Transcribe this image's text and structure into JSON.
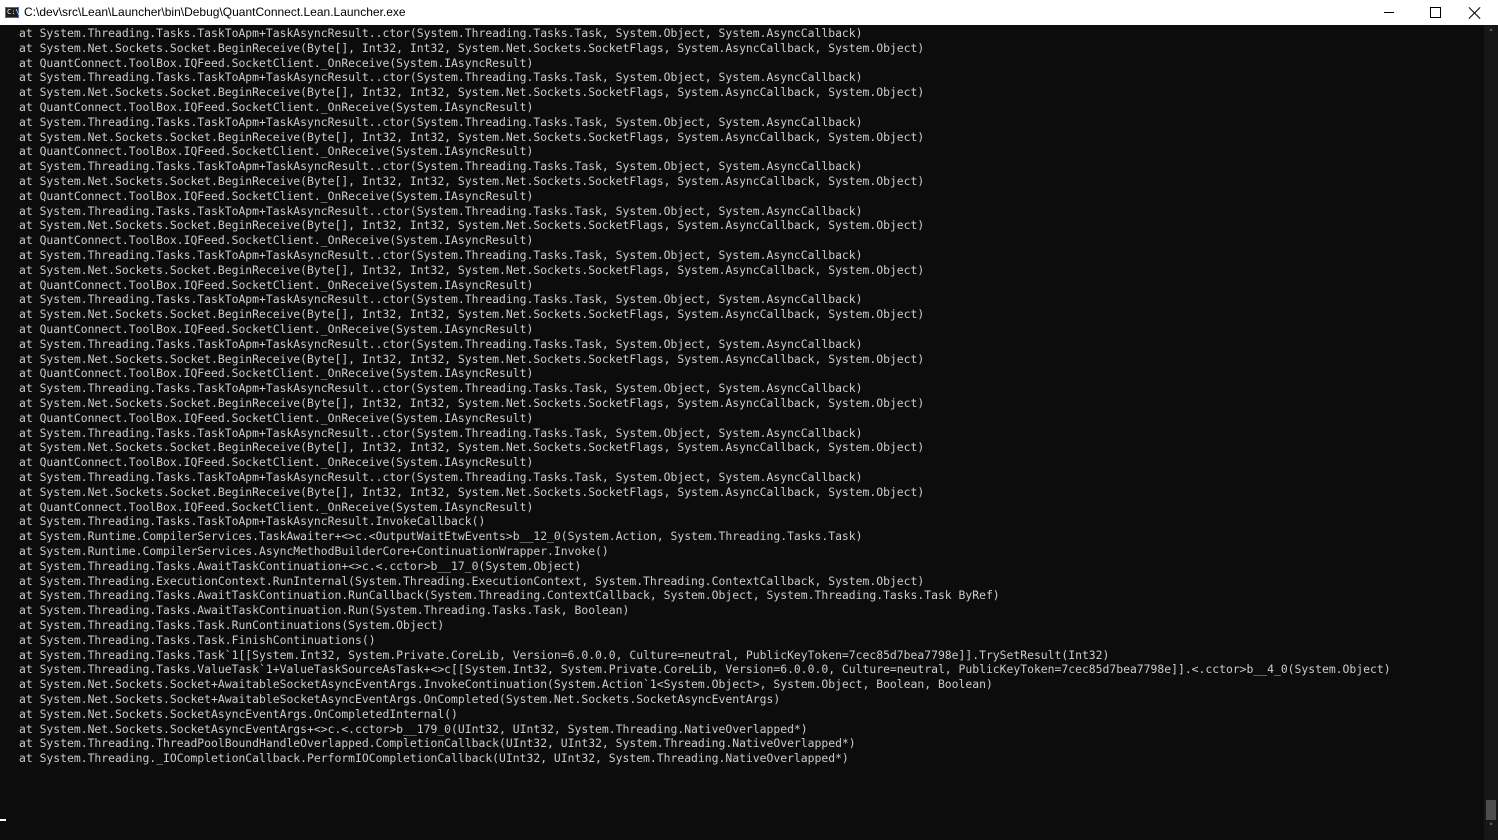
{
  "window": {
    "title": "C:\\dev\\src\\Lean\\Launcher\\bin\\Debug\\QuantConnect.Lean.Launcher.exe",
    "icon_label": "C:\\",
    "icon": "console-app-icon",
    "controls": {
      "minimize_icon": "minimize-icon",
      "maximize_icon": "maximize-icon",
      "close_icon": "close-icon"
    }
  },
  "colors": {
    "console_background": "#0c0c0c",
    "console_text": "#cccccc",
    "titlebar_background": "#ffffff"
  },
  "scrollbar": {
    "up_glyph": "˄",
    "down_glyph": "˅"
  },
  "console_lines": [
    "at System.Threading.Tasks.TaskToApm+TaskAsyncResult..ctor(System.Threading.Tasks.Task, System.Object, System.AsyncCallback)",
    "at System.Net.Sockets.Socket.BeginReceive(Byte[], Int32, Int32, System.Net.Sockets.SocketFlags, System.AsyncCallback, System.Object)",
    "at QuantConnect.ToolBox.IQFeed.SocketClient._OnReceive(System.IAsyncResult)",
    "at System.Threading.Tasks.TaskToApm+TaskAsyncResult..ctor(System.Threading.Tasks.Task, System.Object, System.AsyncCallback)",
    "at System.Net.Sockets.Socket.BeginReceive(Byte[], Int32, Int32, System.Net.Sockets.SocketFlags, System.AsyncCallback, System.Object)",
    "at QuantConnect.ToolBox.IQFeed.SocketClient._OnReceive(System.IAsyncResult)",
    "at System.Threading.Tasks.TaskToApm+TaskAsyncResult..ctor(System.Threading.Tasks.Task, System.Object, System.AsyncCallback)",
    "at System.Net.Sockets.Socket.BeginReceive(Byte[], Int32, Int32, System.Net.Sockets.SocketFlags, System.AsyncCallback, System.Object)",
    "at QuantConnect.ToolBox.IQFeed.SocketClient._OnReceive(System.IAsyncResult)",
    "at System.Threading.Tasks.TaskToApm+TaskAsyncResult..ctor(System.Threading.Tasks.Task, System.Object, System.AsyncCallback)",
    "at System.Net.Sockets.Socket.BeginReceive(Byte[], Int32, Int32, System.Net.Sockets.SocketFlags, System.AsyncCallback, System.Object)",
    "at QuantConnect.ToolBox.IQFeed.SocketClient._OnReceive(System.IAsyncResult)",
    "at System.Threading.Tasks.TaskToApm+TaskAsyncResult..ctor(System.Threading.Tasks.Task, System.Object, System.AsyncCallback)",
    "at System.Net.Sockets.Socket.BeginReceive(Byte[], Int32, Int32, System.Net.Sockets.SocketFlags, System.AsyncCallback, System.Object)",
    "at QuantConnect.ToolBox.IQFeed.SocketClient._OnReceive(System.IAsyncResult)",
    "at System.Threading.Tasks.TaskToApm+TaskAsyncResult..ctor(System.Threading.Tasks.Task, System.Object, System.AsyncCallback)",
    "at System.Net.Sockets.Socket.BeginReceive(Byte[], Int32, Int32, System.Net.Sockets.SocketFlags, System.AsyncCallback, System.Object)",
    "at QuantConnect.ToolBox.IQFeed.SocketClient._OnReceive(System.IAsyncResult)",
    "at System.Threading.Tasks.TaskToApm+TaskAsyncResult..ctor(System.Threading.Tasks.Task, System.Object, System.AsyncCallback)",
    "at System.Net.Sockets.Socket.BeginReceive(Byte[], Int32, Int32, System.Net.Sockets.SocketFlags, System.AsyncCallback, System.Object)",
    "at QuantConnect.ToolBox.IQFeed.SocketClient._OnReceive(System.IAsyncResult)",
    "at System.Threading.Tasks.TaskToApm+TaskAsyncResult..ctor(System.Threading.Tasks.Task, System.Object, System.AsyncCallback)",
    "at System.Net.Sockets.Socket.BeginReceive(Byte[], Int32, Int32, System.Net.Sockets.SocketFlags, System.AsyncCallback, System.Object)",
    "at QuantConnect.ToolBox.IQFeed.SocketClient._OnReceive(System.IAsyncResult)",
    "at System.Threading.Tasks.TaskToApm+TaskAsyncResult..ctor(System.Threading.Tasks.Task, System.Object, System.AsyncCallback)",
    "at System.Net.Sockets.Socket.BeginReceive(Byte[], Int32, Int32, System.Net.Sockets.SocketFlags, System.AsyncCallback, System.Object)",
    "at QuantConnect.ToolBox.IQFeed.SocketClient._OnReceive(System.IAsyncResult)",
    "at System.Threading.Tasks.TaskToApm+TaskAsyncResult..ctor(System.Threading.Tasks.Task, System.Object, System.AsyncCallback)",
    "at System.Net.Sockets.Socket.BeginReceive(Byte[], Int32, Int32, System.Net.Sockets.SocketFlags, System.AsyncCallback, System.Object)",
    "at QuantConnect.ToolBox.IQFeed.SocketClient._OnReceive(System.IAsyncResult)",
    "at System.Threading.Tasks.TaskToApm+TaskAsyncResult..ctor(System.Threading.Tasks.Task, System.Object, System.AsyncCallback)",
    "at System.Net.Sockets.Socket.BeginReceive(Byte[], Int32, Int32, System.Net.Sockets.SocketFlags, System.AsyncCallback, System.Object)",
    "at QuantConnect.ToolBox.IQFeed.SocketClient._OnReceive(System.IAsyncResult)",
    "at System.Threading.Tasks.TaskToApm+TaskAsyncResult.InvokeCallback()",
    "at System.Runtime.CompilerServices.TaskAwaiter+<>c.<OutputWaitEtwEvents>b__12_0(System.Action, System.Threading.Tasks.Task)",
    "at System.Runtime.CompilerServices.AsyncMethodBuilderCore+ContinuationWrapper.Invoke()",
    "at System.Threading.Tasks.AwaitTaskContinuation+<>c.<.cctor>b__17_0(System.Object)",
    "at System.Threading.ExecutionContext.RunInternal(System.Threading.ExecutionContext, System.Threading.ContextCallback, System.Object)",
    "at System.Threading.Tasks.AwaitTaskContinuation.RunCallback(System.Threading.ContextCallback, System.Object, System.Threading.Tasks.Task ByRef)",
    "at System.Threading.Tasks.AwaitTaskContinuation.Run(System.Threading.Tasks.Task, Boolean)",
    "at System.Threading.Tasks.Task.RunContinuations(System.Object)",
    "at System.Threading.Tasks.Task.FinishContinuations()",
    "at System.Threading.Tasks.Task`1[[System.Int32, System.Private.CoreLib, Version=6.0.0.0, Culture=neutral, PublicKeyToken=7cec85d7bea7798e]].TrySetResult(Int32)",
    "at System.Threading.Tasks.ValueTask`1+ValueTaskSourceAsTask+<>c[[System.Int32, System.Private.CoreLib, Version=6.0.0.0, Culture=neutral, PublicKeyToken=7cec85d7bea7798e]].<.cctor>b__4_0(System.Object)",
    "at System.Net.Sockets.Socket+AwaitableSocketAsyncEventArgs.InvokeContinuation(System.Action`1<System.Object>, System.Object, Boolean, Boolean)",
    "at System.Net.Sockets.Socket+AwaitableSocketAsyncEventArgs.OnCompleted(System.Net.Sockets.SocketAsyncEventArgs)",
    "at System.Net.Sockets.SocketAsyncEventArgs.OnCompletedInternal()",
    "at System.Net.Sockets.SocketAsyncEventArgs+<>c.<.cctor>b__179_0(UInt32, UInt32, System.Threading.NativeOverlapped*)",
    "at System.Threading.ThreadPoolBoundHandleOverlapped.CompletionCallback(UInt32, UInt32, System.Threading.NativeOverlapped*)",
    "at System.Threading._IOCompletionCallback.PerformIOCompletionCallback(UInt32, UInt32, System.Threading.NativeOverlapped*)"
  ]
}
